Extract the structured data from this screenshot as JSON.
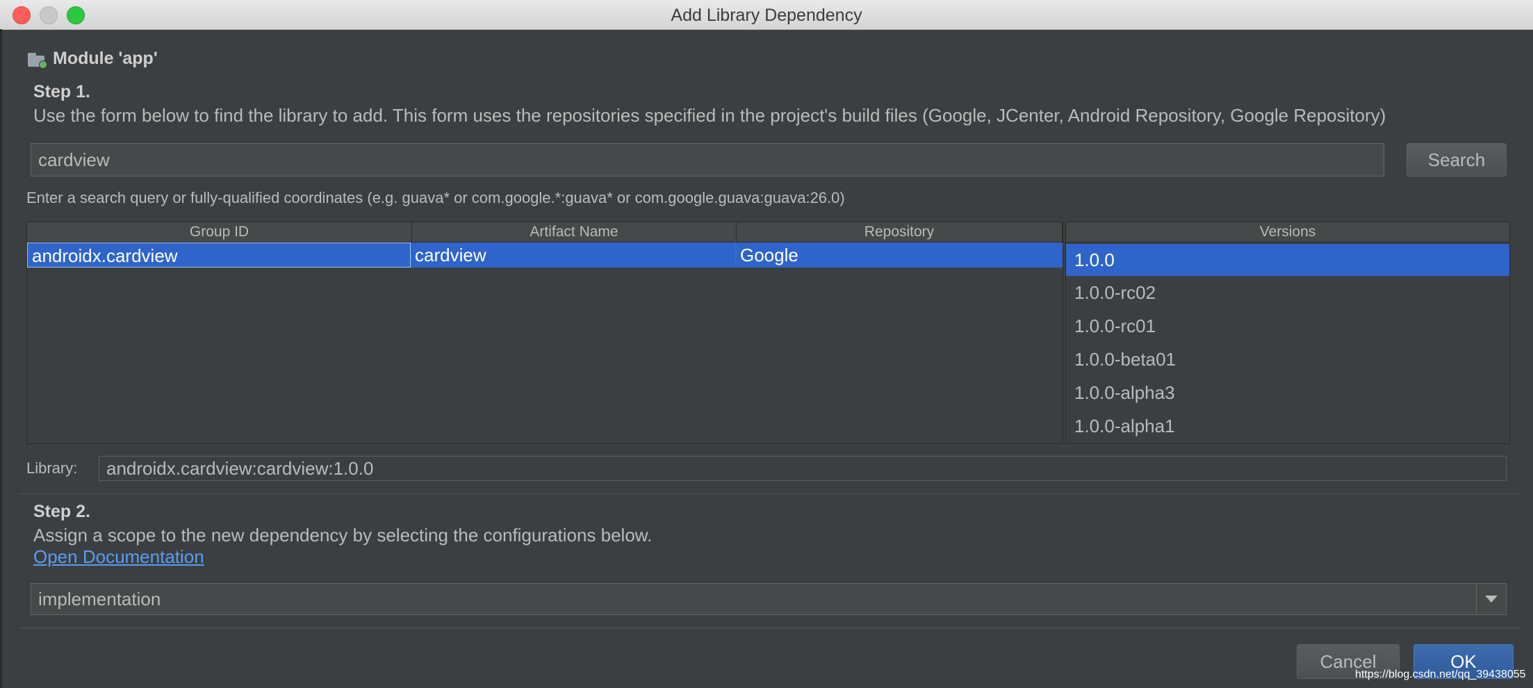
{
  "window": {
    "title": "Add Library Dependency"
  },
  "module": {
    "label": "Module 'app'"
  },
  "step1": {
    "heading": "Step 1.",
    "description": "Use the form below to find the library to add. This form uses the repositories specified in the project's build files (Google, JCenter, Android Repository, Google Repository)"
  },
  "search": {
    "value": "cardview",
    "button_label": "Search",
    "hint": "Enter a search query or fully-qualified coordinates (e.g. guava* or com.google.*:guava* or com.google.guava:guava:26.0)"
  },
  "results": {
    "columns": [
      "Group ID",
      "Artifact Name",
      "Repository"
    ],
    "rows": [
      {
        "group_id": "androidx.cardview",
        "artifact": "cardview",
        "repository": "Google"
      }
    ]
  },
  "versions": {
    "header": "Versions",
    "items": [
      "1.0.0",
      "1.0.0-rc02",
      "1.0.0-rc01",
      "1.0.0-beta01",
      "1.0.0-alpha3",
      "1.0.0-alpha1"
    ],
    "selected": "1.0.0"
  },
  "library": {
    "label": "Library:",
    "value": "androidx.cardview:cardview:1.0.0"
  },
  "step2": {
    "heading": "Step 2.",
    "description": "Assign a scope to the new dependency by selecting the configurations below.",
    "doc_link": "Open Documentation",
    "scope_value": "implementation"
  },
  "footer": {
    "cancel_label": "Cancel",
    "ok_label": "OK",
    "watermark": "https://blog.csdn.net/qq_39438055"
  },
  "colors": {
    "background": "#3c3f41",
    "selection": "#2f65ca",
    "link": "#589df6"
  }
}
